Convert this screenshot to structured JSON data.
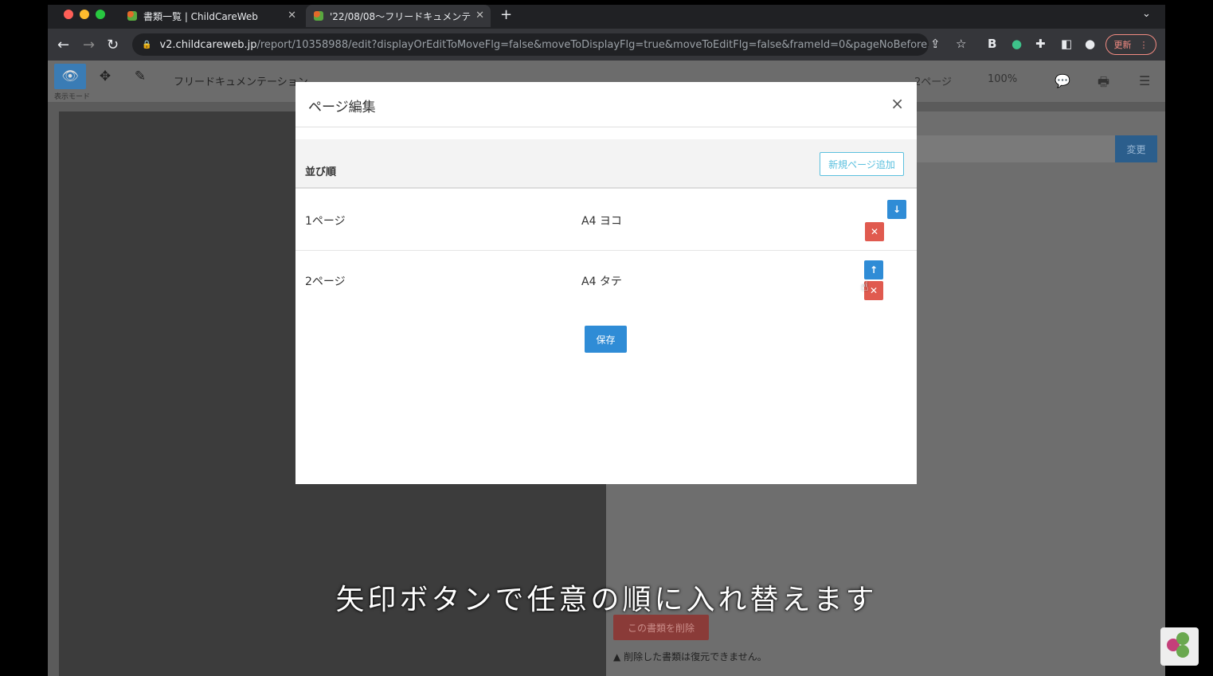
{
  "browser": {
    "tabs": [
      {
        "title": "書類一覧 | ChildCareWeb",
        "active": false
      },
      {
        "title": "'22/08/08〜フリードキュメンテ",
        "active": true
      }
    ],
    "new_tab": "+",
    "url_host": "v2.childcareweb.jp",
    "url_path": "/report/10358988/edit?displayOrEditToMoveFlg=false&moveToDisplayFlg=true&moveToEditFlg=false&frameId=0&pageNoBefore...",
    "update_label": "更新"
  },
  "app": {
    "mode_label": "表示モード",
    "doc_title": "フリードキュメンテーション",
    "page_select": "2ページ",
    "zoom": "100%",
    "change_button": "変更",
    "delete_doc_button": "この書類を削除",
    "delete_warning": "削除した書類は復元できません。"
  },
  "modal": {
    "title": "ページ編集",
    "close": "×",
    "column_order": "並び順",
    "add_page_button": "新規ページ追加",
    "rows": [
      {
        "page": "1ページ",
        "size": "A4 ヨコ"
      },
      {
        "page": "2ページ",
        "size": "A4 タテ"
      }
    ],
    "save_button": "保存"
  },
  "caption": "矢印ボタンで任意の順に入れ替えます",
  "colors": {
    "primary": "#2f8cd6",
    "danger": "#e05a4f",
    "info": "#5bc0de"
  }
}
